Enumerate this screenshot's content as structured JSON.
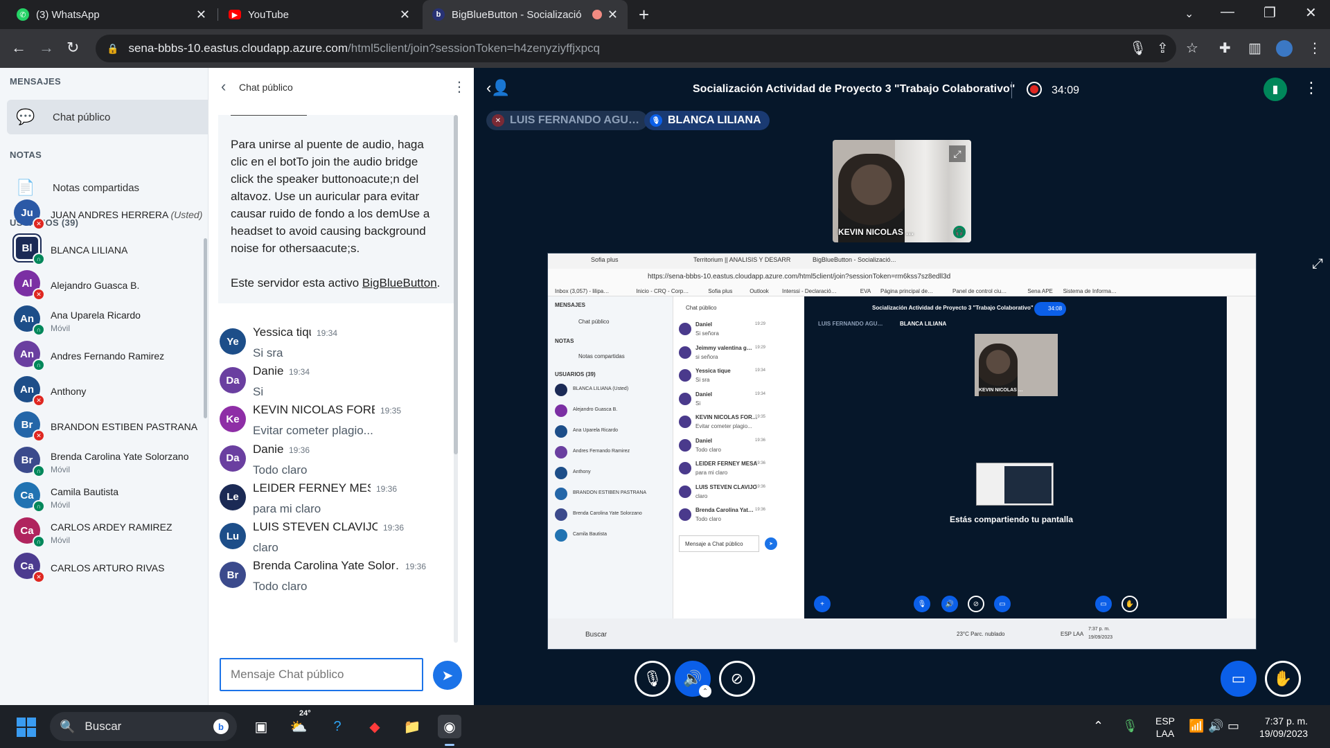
{
  "browser": {
    "tabs": [
      {
        "title": "(3) WhatsApp",
        "icon": "whatsapp-icon",
        "color": "#25d366"
      },
      {
        "title": "YouTube",
        "icon": "youtube-icon",
        "color": "#ff0000"
      },
      {
        "title": "BigBlueButton - Socializació",
        "icon": "bigbluebutton-icon",
        "color": "#283274",
        "recording": true
      }
    ],
    "url_host": "sena-bbbs-10.eastus.cloudapp.azure.com",
    "url_path": "/html5client/join?sessionToken=h4zenyziyffjxpcq"
  },
  "sidebar": {
    "messages_title": "MENSAJES",
    "public_chat": "Chat público",
    "notes_title": "NOTAS",
    "shared_notes": "Notas compartidas",
    "users_title": "USUARIOS (39)",
    "users": [
      {
        "initials": "Ju",
        "name": "JUAN ANDRES HERRERA",
        "suffix": "(Usted)",
        "sub": "",
        "color": "#2b59a6",
        "status": "muted"
      },
      {
        "initials": "Bl",
        "name": "BLANCA LILIANA",
        "suffix": "",
        "sub": "",
        "color": "#1b2a55",
        "status": "audio",
        "presenter": true
      },
      {
        "initials": "Al",
        "name": "Alejandro Guasca B.",
        "suffix": "",
        "sub": "",
        "color": "#7b2fa3",
        "status": "muted"
      },
      {
        "initials": "An",
        "name": "Ana Uparela Ricardo",
        "suffix": "",
        "sub": "Móvil",
        "color": "#1d4e89",
        "status": "audio"
      },
      {
        "initials": "An",
        "name": "Andres Fernando Ramirez",
        "suffix": "",
        "sub": "",
        "color": "#6a3fa0",
        "status": "audio"
      },
      {
        "initials": "An",
        "name": "Anthony",
        "suffix": "",
        "sub": "",
        "color": "#1d4e89",
        "status": "muted"
      },
      {
        "initials": "Br",
        "name": "BRANDON ESTIBEN PASTRANA",
        "suffix": "",
        "sub": "",
        "color": "#2466a8",
        "status": "muted"
      },
      {
        "initials": "Br",
        "name": "Brenda Carolina Yate Solorzano",
        "suffix": "",
        "sub": "Móvil",
        "color": "#3b4a8c",
        "status": "audio"
      },
      {
        "initials": "Ca",
        "name": "Camila Bautista",
        "suffix": "",
        "sub": "Móvil",
        "color": "#2173b2",
        "status": "audio"
      },
      {
        "initials": "Ca",
        "name": "CARLOS ARDEY RAMIREZ",
        "suffix": "",
        "sub": "Móvil",
        "color": "#b0245e",
        "status": "audio"
      },
      {
        "initials": "Ca",
        "name": "CARLOS ARTURO RIVAS",
        "suffix": "",
        "sub": "",
        "color": "#4c3b8f",
        "status": "muted"
      }
    ]
  },
  "chat": {
    "title": "Chat público",
    "welcome_text": "Para unirse al puente de audio, haga clic en el botTo join the audio bridge click the speaker buttonoacute;n del altavoz. Use un auricular para evitar causar ruido de fondo a los demUse a headset to avoid causing background noise for othersaacute;s.",
    "welcome_server_prefix": "Este servidor esta activo ",
    "welcome_server_link": "BigBlueButton",
    "welcome_server_suffix": ".",
    "messages": [
      {
        "initials": "Ye",
        "name": "Yessica tique",
        "time": "19:34",
        "text": "Si sra",
        "color": "#1d4e89"
      },
      {
        "initials": "Da",
        "name": "Daniel",
        "time": "19:34",
        "text": "Si",
        "color": "#6a3fa0"
      },
      {
        "initials": "Ke",
        "name": "KEVIN NICOLAS FORERO",
        "time": "19:35",
        "text": "Evitar cometer plagio...",
        "color": "#8e2ea6"
      },
      {
        "initials": "Da",
        "name": "Daniel",
        "time": "19:36",
        "text": "Todo claro",
        "color": "#6a3fa0"
      },
      {
        "initials": "Le",
        "name": "LEIDER FERNEY MESA",
        "time": "19:36",
        "text": "para mi claro",
        "color": "#1b2a55"
      },
      {
        "initials": "Lu",
        "name": "LUIS STEVEN CLAVIJO",
        "time": "19:36",
        "text": "claro",
        "color": "#1d4e89"
      },
      {
        "initials": "Br",
        "name": "Brenda Carolina Yate Solor…",
        "time": "19:36",
        "text": "Todo claro",
        "color": "#3b4a8c"
      }
    ],
    "input_placeholder": "Mensaje Chat público"
  },
  "meeting": {
    "title": "Socialización Actividad de Proyecto 3 \"Trabajo Colaborativo\"",
    "recording_time": "34:09",
    "talkers": [
      {
        "name": "LUIS FERNANDO AGU…",
        "state": "muted"
      },
      {
        "name": "BLANCA LILIANA",
        "state": "speaking"
      }
    ],
    "webcam_name": "KEVIN NICOLAS …",
    "screenshare": {
      "tabs": [
        "Sofia plus",
        "Territorium || ANALISIS Y DESARR…",
        "BigBlueButton - Socializació…"
      ],
      "url": "https://sena-bbbs-10.eastus.cloudapp.azure.com/html5client/join?sessionToken=rm6kss7sz8edll3d",
      "bookmarks": [
        "Inbox (3,057) - lilipa…",
        "Inicio - CRQ - Corp…",
        "Sofia plus",
        "Outlook",
        "Interssi - Declaració…",
        "EVA",
        "Página principal de…",
        "Panel de control ciu…",
        "Sena APE",
        "Sistema de Informa…"
      ],
      "left_users": [
        "BLANCA LILIANA (Usted)",
        "Alejandro Guasca B.",
        "Ana Uparela Ricardo",
        "Andres Fernando Ramirez",
        "Anthony",
        "BRANDON ESTIBEN PASTRANA",
        "Brenda Carolina Yate Solorzano",
        "Camila Bautista"
      ],
      "chat": [
        {
          "name": "Daniel",
          "time": "19:29",
          "text": "Si señora"
        },
        {
          "name": "Jeimmy valentina g…",
          "time": "19:29",
          "text": "si señora"
        },
        {
          "name": "Yessica tique",
          "time": "19:34",
          "text": "Si sra"
        },
        {
          "name": "Daniel",
          "time": "19:34",
          "text": "Si"
        },
        {
          "name": "KEVIN NICOLAS FOR…",
          "time": "19:35",
          "text": "Evitar cometer plagio..."
        },
        {
          "name": "Daniel",
          "time": "19:36",
          "text": "Todo claro"
        },
        {
          "name": "LEIDER FERNEY MESA",
          "time": "19:36",
          "text": "para mi claro"
        },
        {
          "name": "LUIS STEVEN CLAVIJO",
          "time": "19:36",
          "text": "claro"
        },
        {
          "name": "Brenda Carolina Yat…",
          "time": "19:36",
          "text": "Todo claro"
        }
      ],
      "inner_time": "34:08",
      "sharing_text": "Estás compartiendo tu pantalla",
      "chat_placeholder": "Mensaje a Chat público",
      "taskbar_search": "Buscar",
      "weather": "23°C Parc. nublado",
      "lang": "ESP LAA",
      "time": "7:37 p. m.",
      "date": "19/09/2023"
    }
  },
  "taskbar": {
    "search": "Buscar",
    "weather_temp": "24°",
    "lang_top": "ESP",
    "lang_bottom": "LAA",
    "time": "7:37 p. m.",
    "date": "19/09/2023"
  }
}
